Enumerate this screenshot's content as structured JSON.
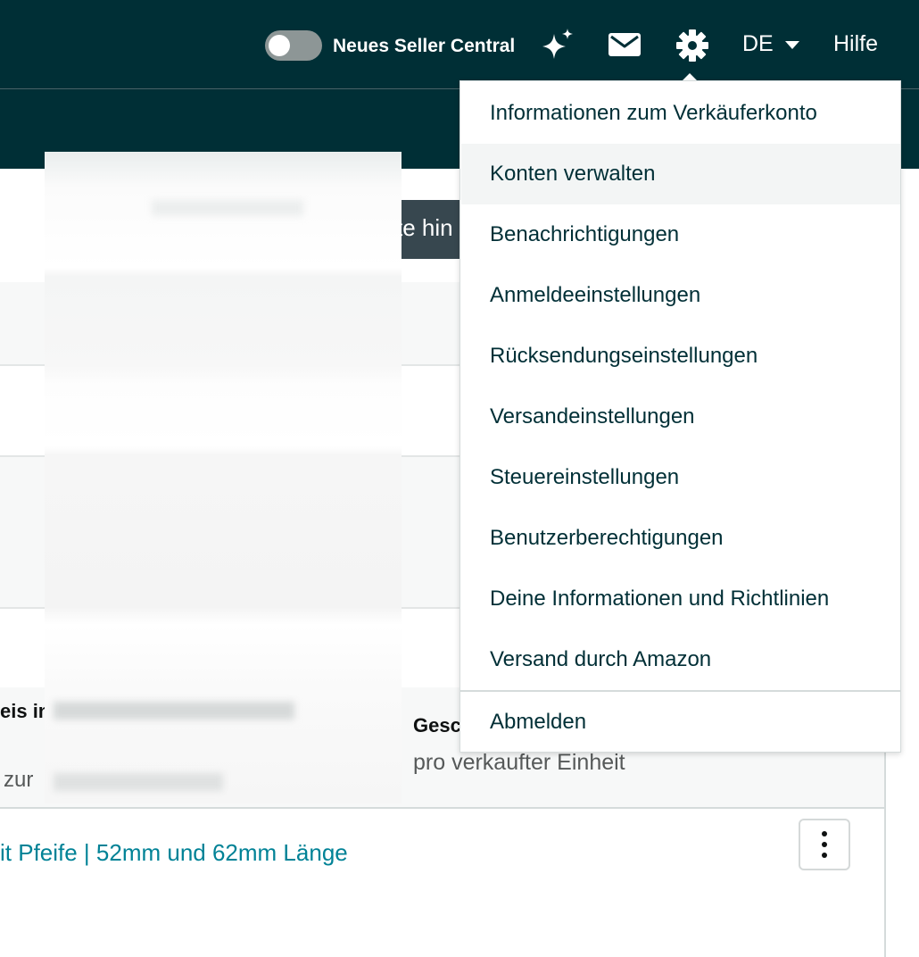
{
  "header": {
    "toggle_label": "Neues Seller Central",
    "language": "DE",
    "help": "Hilfe",
    "icons": [
      "sparkle-icon",
      "mail-icon",
      "gear-icon",
      "caret-down-icon"
    ]
  },
  "page": {
    "button_partial_text": "te hin",
    "table": {
      "col1_header_partial": "eis in",
      "col1_sub_partial": "zur",
      "col2_header_partial": "Gesc",
      "col2_sub": "pro verkaufter Einheit",
      "row1_product_link_partial": "it Pfeife | 52mm und 62mm Länge"
    }
  },
  "settings_menu": {
    "items": [
      {
        "label": "Informationen zum Verkäuferkonto"
      },
      {
        "label": "Konten verwalten"
      },
      {
        "label": "Benachrichtigungen"
      },
      {
        "label": "Anmeldeeinstellungen"
      },
      {
        "label": "Rücksendungseinstellungen"
      },
      {
        "label": "Versandeinstellungen"
      },
      {
        "label": "Steuereinstellungen"
      },
      {
        "label": "Benutzerberechtigungen"
      },
      {
        "label": "Deine Informationen und Richtlinien"
      },
      {
        "label": "Versand durch Amazon"
      }
    ],
    "hovered_item": "Konten verwalten",
    "logout": "Abmelden"
  },
  "colors": {
    "header_bg": "#002f36",
    "link": "#008296",
    "menu_text": "#002f36",
    "menu_hover_bg": "#f3f5f5"
  }
}
